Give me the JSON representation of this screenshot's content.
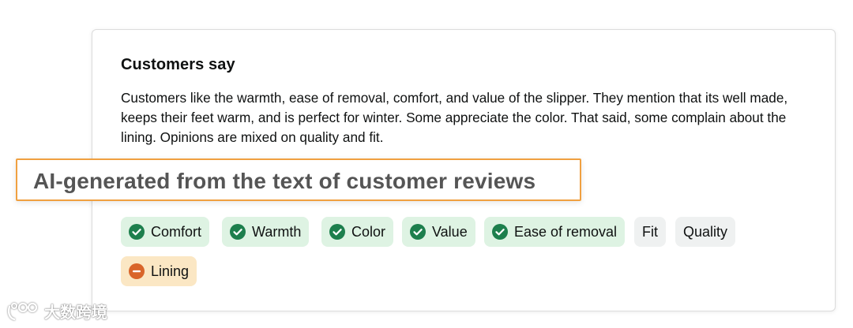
{
  "customers_say": {
    "title": "Customers say",
    "summary": "Customers like the warmth, ease of removal, comfort, and value of the slipper. They mention that its well made, keeps their feet warm, and is perfect for winter. Some appreciate the color. That said, some complain about the lining. Opinions are mixed on quality and fit."
  },
  "ai_callout": {
    "text": "AI-generated from the text of customer reviews"
  },
  "aspects": [
    {
      "label": "Comfort",
      "sentiment": "positive",
      "icon": "check-circle-icon"
    },
    {
      "label": "Warmth",
      "sentiment": "positive",
      "icon": "check-circle-icon"
    },
    {
      "label": "Color",
      "sentiment": "positive",
      "icon": "check-circle-icon"
    },
    {
      "label": "Value",
      "sentiment": "positive",
      "icon": "check-circle-icon"
    },
    {
      "label": "Ease of removal",
      "sentiment": "positive",
      "icon": "check-circle-icon"
    },
    {
      "label": "Fit",
      "sentiment": "mixed",
      "icon": ""
    },
    {
      "label": "Quality",
      "sentiment": "mixed",
      "icon": ""
    },
    {
      "label": "Lining",
      "sentiment": "negative",
      "icon": "minus-circle-icon"
    }
  ],
  "colors": {
    "positive_chip": "#def3e3",
    "positive_icon": "#1d7f4d",
    "mixed_chip": "#eff1f1",
    "negative_chip": "#fbe7c4",
    "negative_icon": "#d9652a",
    "callout_border": "#f0a040"
  },
  "watermark": {
    "text": "大数跨境"
  }
}
